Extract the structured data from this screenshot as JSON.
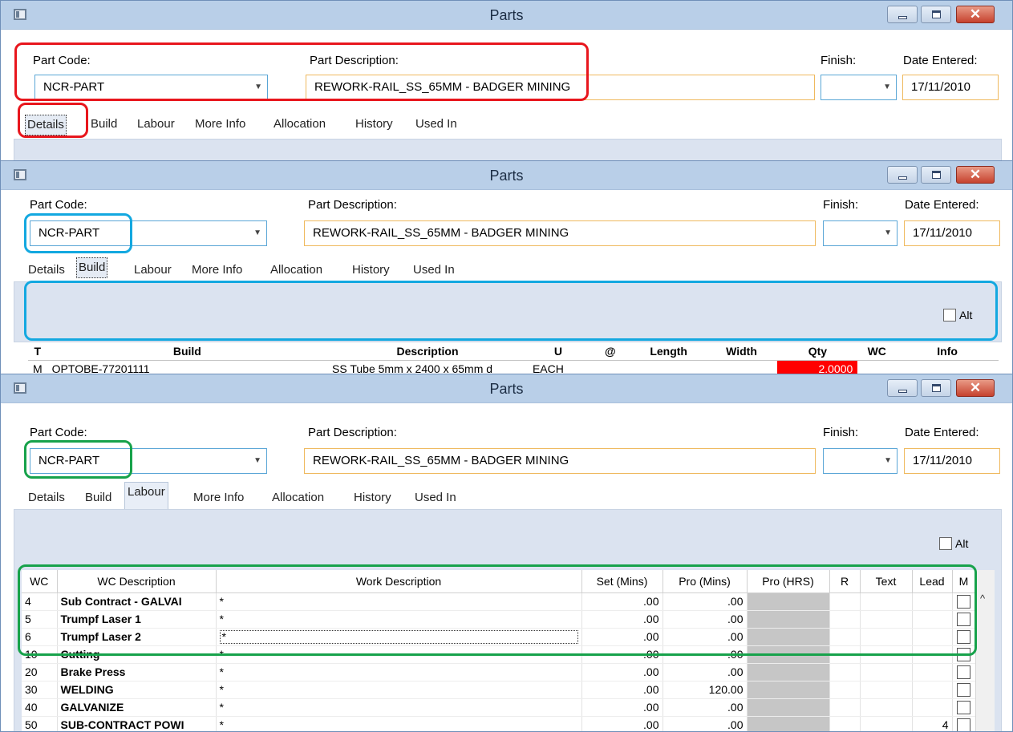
{
  "window": {
    "title": "Parts",
    "close_glyph": "✕",
    "minimize_icon": "minimize-icon",
    "maximize_icon": "maximize-icon"
  },
  "form": {
    "part_code_label": "Part Code:",
    "part_code_value": "NCR-PART",
    "part_desc_label": "Part Description:",
    "part_desc_value": "REWORK-RAIL_SS_65MM - BADGER MINING",
    "finish_label": "Finish:",
    "finish_value": "",
    "date_label": "Date Entered:",
    "date_value": "17/11/2010",
    "dropdown_arrow": "▼"
  },
  "tabs": [
    "Details",
    "Build",
    "Labour",
    "More Info",
    "Allocation",
    "History",
    "Used In"
  ],
  "alt_label": "Alt",
  "build_grid": {
    "headers": [
      "T",
      "Build",
      "Description",
      "U",
      "@",
      "Length",
      "Width",
      "Qty",
      "WC",
      "Info"
    ],
    "rows": [
      {
        "t": "M",
        "build": "OPTOBE-77201111",
        "description": "SS Tube 5mm x 2400 x 65mm d",
        "u": "EACH",
        "at": "",
        "length": "",
        "width": "",
        "qty": "2.0000",
        "wc": "",
        "info": ""
      }
    ]
  },
  "labour_grid": {
    "headers": [
      "WC",
      "WC Description",
      "Work Description",
      "Set (Mins)",
      "Pro (Mins)",
      "Pro (HRS)",
      "R",
      "Text",
      "Lead",
      "M"
    ],
    "rows": [
      {
        "wc": "4",
        "desc": "Sub Contract - GALVAI",
        "work": "*",
        "set": ".00",
        "pro": ".00",
        "lead": ""
      },
      {
        "wc": "5",
        "desc": "Trumpf Laser 1",
        "work": "*",
        "set": ".00",
        "pro": ".00",
        "lead": ""
      },
      {
        "wc": "6",
        "desc": "Trumpf Laser 2",
        "work": "*",
        "set": ".00",
        "pro": ".00",
        "lead": ""
      },
      {
        "wc": "10",
        "desc": "Cutting",
        "work": "*",
        "set": ".00",
        "pro": ".00",
        "lead": ""
      },
      {
        "wc": "20",
        "desc": "Brake Press",
        "work": "*",
        "set": ".00",
        "pro": ".00",
        "lead": ""
      },
      {
        "wc": "30",
        "desc": "WELDING",
        "work": "*",
        "set": ".00",
        "pro": "120.00",
        "lead": ""
      },
      {
        "wc": "40",
        "desc": "GALVANIZE",
        "work": "*",
        "set": ".00",
        "pro": ".00",
        "lead": ""
      },
      {
        "wc": "50",
        "desc": "SUB-CONTRACT POWI",
        "work": "*",
        "set": ".00",
        "pro": ".00",
        "lead": "4"
      }
    ],
    "scroll_up_glyph": "^"
  },
  "colors": {
    "highlight_1": "#e8161d",
    "highlight_2": "#13a8e0",
    "highlight_3": "#17a24b",
    "qty_highlight": "#ff0000"
  }
}
